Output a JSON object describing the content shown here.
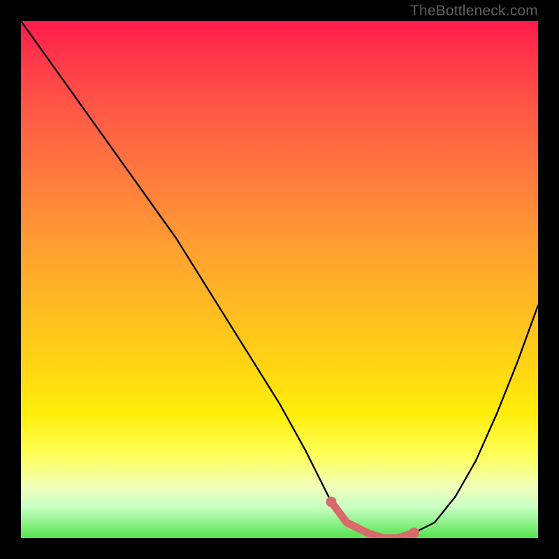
{
  "watermark": "TheBottleneck.com",
  "chart_data": {
    "type": "line",
    "title": "",
    "xlabel": "",
    "ylabel": "",
    "xlim": [
      0,
      100
    ],
    "ylim": [
      0,
      100
    ],
    "series": [
      {
        "name": "bottleneck-curve",
        "x": [
          0,
          5,
          10,
          15,
          20,
          25,
          30,
          35,
          40,
          45,
          50,
          55,
          58,
          60,
          63,
          67,
          70,
          73,
          76,
          80,
          84,
          88,
          92,
          96,
          100
        ],
        "y": [
          100,
          93,
          86,
          79,
          72,
          65,
          58,
          50,
          42,
          34,
          26,
          17,
          11,
          7,
          3,
          1,
          0,
          0,
          1,
          3,
          8,
          15,
          24,
          34,
          45
        ]
      }
    ],
    "highlight_segment": {
      "name": "optimal-band",
      "x": [
        60,
        63,
        67,
        70,
        73,
        76
      ],
      "y": [
        7,
        3,
        1,
        0,
        0,
        1
      ]
    },
    "colors": {
      "curve": "#000000",
      "highlight": "#d96a6a",
      "gradient_top": "#ff1a4b",
      "gradient_bottom": "#54e44e"
    }
  }
}
